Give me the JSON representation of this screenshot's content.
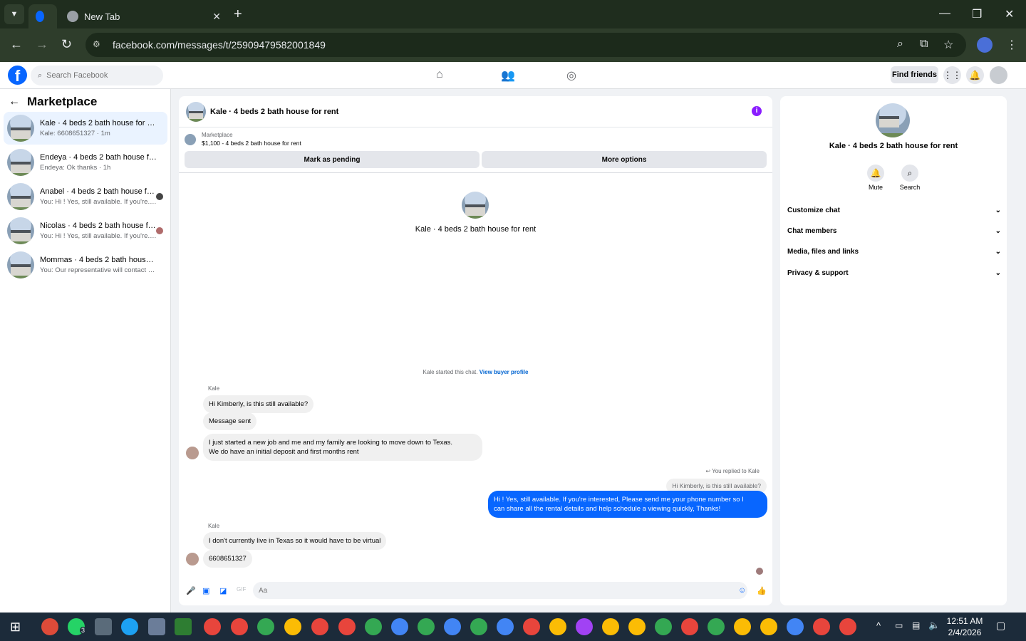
{
  "browser": {
    "tabs": [
      {
        "label": "",
        "favicon": "facebook-icon",
        "active": true
      },
      {
        "label": "New Tab",
        "favicon": "chrome-icon",
        "active": false
      }
    ],
    "url": "facebook.com/messages/t/25909479582001849",
    "window_controls": [
      "minimize",
      "restore",
      "close"
    ]
  },
  "fb_header": {
    "search_placeholder": "Search Facebook",
    "find_friends_label": "Find friends"
  },
  "left": {
    "title": "Marketplace",
    "conversations": [
      {
        "name": "Kale · 4 beds 2 bath house for rent",
        "preview": "Kale: 6608651327 · 1m",
        "selected": true
      },
      {
        "name": "Endeya · 4 beds 2 bath house for r...",
        "preview": "Endeya: Ok thanks · 1h"
      },
      {
        "name": "Anabel · 4 beds 2 bath house fo...",
        "preview": "You: Hi ! Yes, still available. If you're... · 1h"
      },
      {
        "name": "Nicolas · 4 beds 2 bath house fo...",
        "preview": "You: Hi ! Yes, still available. If you're... · 1h"
      },
      {
        "name": "Mommas · 4 beds 2 bath house fo...",
        "preview": "You: Our representative will contact y... · 4h"
      }
    ]
  },
  "chat": {
    "title": "Kale · 4 beds 2 bath house for rent",
    "listing_source": "Marketplace",
    "listing_price_title": "$1,100 - 4 beds 2 bath house for rent",
    "mark_pending": "Mark as pending",
    "more_options": "More options",
    "center_name": "Kale · 4 beds 2 bath house for rent",
    "started_text": "Kale started this chat.",
    "view_buyer_profile": "View buyer profile",
    "sender_label_1": "Kale",
    "msg1": "Hi Kimberly, is this still available?",
    "msg2": "Message sent",
    "msg3_line1": "I just started a new job and me and my family are looking to move down to Texas.",
    "msg3_line2": "We do have an initial deposit and first months rent",
    "replied_to": "You replied to Kale",
    "reply_quote": "Hi Kimberly, is this still available?",
    "my_msg_line1": "Hi ! Yes, still available. If you're interested, Please send me your phone number so I",
    "my_msg_line2": "can share all the rental details and help schedule a viewing quickly, Thanks!",
    "sender_label_2": "Kale",
    "msg4": "I don't currently live in Texas so it would have to be virtual",
    "msg5": "6608651327",
    "composer_placeholder": "Aa"
  },
  "right": {
    "name": "Kale · 4 beds 2 bath house for rent",
    "mute_label": "Mute",
    "search_label": "Search",
    "sections": [
      "Customize chat",
      "Chat members",
      "Media, files and links",
      "Privacy & support"
    ]
  },
  "taskbar": {
    "time": "12:51 AM",
    "date": "2/4/2026",
    "whatsapp_badge": "3"
  },
  "colors": {
    "fb_blue": "#0866ff",
    "browser_dark": "#1f2d1e",
    "taskbar": "#1c2b3a"
  }
}
